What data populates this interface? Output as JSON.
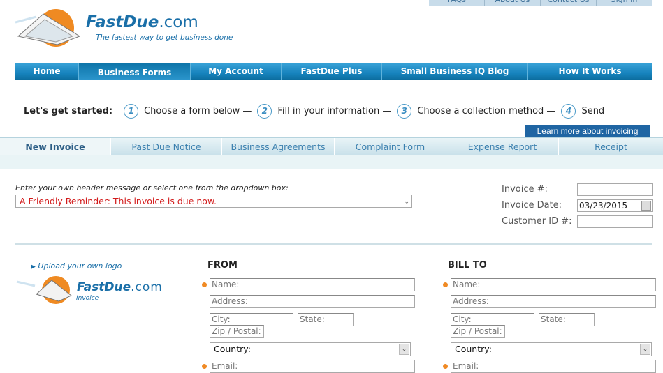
{
  "top_links": [
    "FAQs",
    "About Us",
    "Contact Us",
    "Sign In"
  ],
  "brand": {
    "name": "FastDue",
    "tld": ".com",
    "tagline": "The fastest way to get business done"
  },
  "nav": [
    {
      "label": "Home"
    },
    {
      "label": "Business Forms",
      "active": true
    },
    {
      "label": "My Account"
    },
    {
      "label": "FastDue Plus"
    },
    {
      "label": "Small Business IQ Blog"
    },
    {
      "label": "How It Works"
    }
  ],
  "steps": {
    "intro": "Let's get started:",
    "items": [
      {
        "n": "1",
        "text": "Choose a form below —"
      },
      {
        "n": "2",
        "text": "Fill in your information —"
      },
      {
        "n": "3",
        "text": "Choose a collection method —"
      },
      {
        "n": "4",
        "text": "Send"
      }
    ]
  },
  "learn_more": "Learn more about invoicing",
  "form_tabs": [
    {
      "label": "New Invoice",
      "active": true
    },
    {
      "label": "Past Due Notice"
    },
    {
      "label": "Business Agreements"
    },
    {
      "label": "Complaint Form"
    },
    {
      "label": "Expense Report"
    },
    {
      "label": "Receipt"
    }
  ],
  "header_message": {
    "label": "Enter your own header message or select one from the dropdown box:",
    "value": "A Friendly Reminder: This invoice is due now."
  },
  "invoice_meta": {
    "invoice_no_label": "Invoice #:",
    "invoice_no": "",
    "date_label": "Invoice Date:",
    "date": "03/23/2015",
    "customer_label": "Customer ID #:",
    "customer_id": ""
  },
  "logo": {
    "upload_label": "Upload your own logo",
    "name": "FastDue",
    "tld": ".com",
    "sub": "Invoice"
  },
  "from": {
    "title": "FROM",
    "name": "Name:",
    "address": "Address:",
    "city": "City:",
    "state": "State:",
    "zip": "Zip / Postal:",
    "country": "Country:",
    "email": "Email:"
  },
  "bill_to": {
    "title": "BILL TO",
    "name": "Name:",
    "address": "Address:",
    "city": "City:",
    "state": "State:",
    "zip": "Zip / Postal:",
    "country": "Country:",
    "email": "Email:"
  },
  "colors": {
    "brand_blue": "#1a6fa8",
    "accent_orange": "#f08a24",
    "nav_blue": "#1783bd",
    "message_red": "#d21a1a"
  }
}
